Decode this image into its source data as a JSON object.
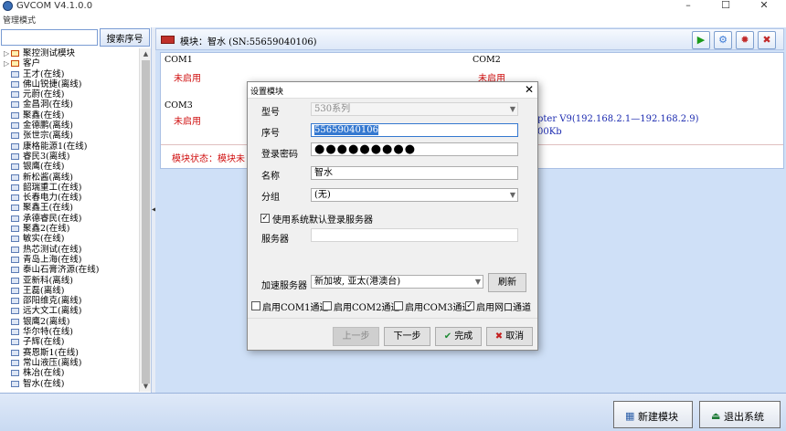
{
  "window": {
    "title": "GVCOM V4.1.0.0",
    "minimize": "–",
    "maximize": "☐",
    "close": "✕"
  },
  "menubar": {
    "mode": "管理模式"
  },
  "sidebar": {
    "search_placeholder": "",
    "search_button": "搜索序号",
    "tree": [
      {
        "label": "聚控测试模块",
        "type": "group",
        "icon": "expand-icon"
      },
      {
        "label": "客户",
        "type": "group",
        "icon": "expand-icon"
      },
      {
        "label": "王才(在线)"
      },
      {
        "label": "佛山锐捷(离线)"
      },
      {
        "label": "元蔚(在线)"
      },
      {
        "label": "金昌洞(在线)"
      },
      {
        "label": "聚鑫(在线)"
      },
      {
        "label": "金德鹏(离线)"
      },
      {
        "label": "张世宗(离线)"
      },
      {
        "label": "康格能源1(在线)"
      },
      {
        "label": "睿民3(离线)"
      },
      {
        "label": "银鹰(在线)"
      },
      {
        "label": "新松酱(离线)"
      },
      {
        "label": "韶瑞重工(在线)"
      },
      {
        "label": "长春电力(在线)"
      },
      {
        "label": "聚鑫王(在线)"
      },
      {
        "label": "承德睿民(在线)"
      },
      {
        "label": "聚鑫2(在线)"
      },
      {
        "label": "敏实(在线)"
      },
      {
        "label": "热芯测试(在线)"
      },
      {
        "label": "青岛上海(在线)"
      },
      {
        "label": "泰山石膏济源(在线)"
      },
      {
        "label": "亚新科(离线)"
      },
      {
        "label": "王磊(离线)"
      },
      {
        "label": "邵阳维克(离线)"
      },
      {
        "label": "远大文工(离线)"
      },
      {
        "label": "银鹰2(离线)"
      },
      {
        "label": "华尔特(在线)"
      },
      {
        "label": "子辉(在线)"
      },
      {
        "label": "赛恩斯1(在线)"
      },
      {
        "label": "常山液压(离线)"
      },
      {
        "label": "株冶(在线)"
      },
      {
        "label": "智水(在线)"
      }
    ]
  },
  "module": {
    "title": "模块：智水 (SN:55659040106)",
    "ports": [
      {
        "label": "COM1",
        "state": "未启用"
      },
      {
        "label": "COM2",
        "state": "未启用"
      },
      {
        "label": "COM3",
        "state": "未启用"
      }
    ],
    "status": "模块状态：模块未",
    "adapter_line1": "pter V9(192.168.2.1—192.168.2.9)",
    "adapter_line2": "00Kb"
  },
  "bottom": {
    "new_module": "新建模块",
    "exit": "退出系统"
  },
  "dialog": {
    "title": "设置模块",
    "close": "✕",
    "model_label": "型号",
    "model_value": "530系列",
    "serial_label": "序号",
    "serial_value": "55659040106",
    "password_label": "登录密码",
    "password_value": "●●●●●●●●●",
    "name_label": "名称",
    "name_value": "智水",
    "group_label": "分组",
    "group_value": "(无)",
    "use_default_server": "使用系统默认登录服务器",
    "server_label": "服务器",
    "server_value": "",
    "accel_label": "加速服务器",
    "accel_value": "新加坡, 亚太(港澳台)",
    "refresh": "刷新",
    "enable_com1": "启用COM1通道",
    "enable_com2": "启用COM2通道",
    "enable_com3": "启用COM3通道",
    "enable_net": "启用网口通道",
    "prev": "上一步",
    "next": "下一步",
    "finish": "完成",
    "cancel": "取消"
  }
}
